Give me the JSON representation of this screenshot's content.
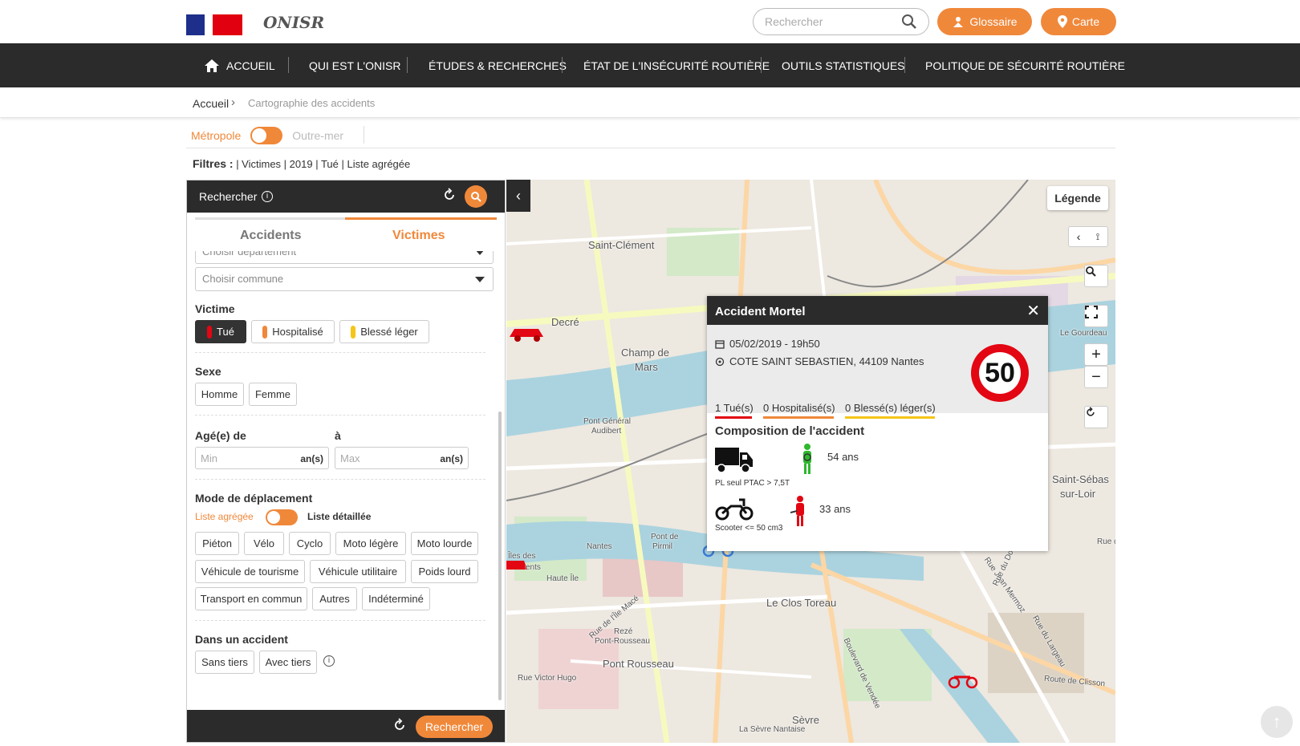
{
  "header": {
    "logo_text": "ONISR",
    "search_placeholder": "Rechercher",
    "glossaire_label": "Glossaire",
    "carte_label": "Carte"
  },
  "nav": {
    "items": [
      {
        "label": "ACCUEIL"
      },
      {
        "label": "QUI EST L'ONISR"
      },
      {
        "label": "ÉTUDES & RECHERCHES"
      },
      {
        "label": "ÉTAT DE L'INSÉCURITÉ ROUTIÈRE"
      },
      {
        "label": "OUTILS STATISTIQUES"
      },
      {
        "label": "POLITIQUE DE SÉCURITÉ ROUTIÈRE"
      }
    ]
  },
  "breadcrumb": {
    "home": "Accueil",
    "current": "Cartographie des accidents"
  },
  "region": {
    "metropole": "Métropole",
    "outremer": "Outre-mer"
  },
  "filters": {
    "label": "Filtres :",
    "value": " | Victimes | 2019 | Tué | Liste agrégée"
  },
  "panel": {
    "title": "Rechercher",
    "tabs": {
      "accidents": "Accidents",
      "victimes": "Victimes"
    },
    "departement_placeholder": "Choisir département",
    "commune_placeholder": "Choisir commune",
    "victime": {
      "label": "Victime",
      "options": [
        "Tué",
        "Hospitalisé",
        "Blessé léger"
      ]
    },
    "sexe": {
      "label": "Sexe",
      "options": [
        "Homme",
        "Femme"
      ]
    },
    "age": {
      "label_from": "Agé(e) de",
      "label_to": "à",
      "min_placeholder": "Min",
      "max_placeholder": "Max",
      "unit": "an(s)"
    },
    "mode": {
      "label": "Mode de déplacement",
      "toggle_left": "Liste agrégée",
      "toggle_right": "Liste détaillée",
      "options": [
        "Piéton",
        "Vélo",
        "Cyclo",
        "Moto légère",
        "Moto lourde",
        "Véhicule de tourisme",
        "Véhicule utilitaire",
        "Poids lourd",
        "Transport en commun",
        "Autres",
        "Indéterminé"
      ]
    },
    "accident": {
      "label": "Dans un accident",
      "options": [
        "Sans tiers",
        "Avec tiers"
      ]
    },
    "search_button": "Rechercher"
  },
  "map": {
    "legend_button": "Légende",
    "labels": [
      "Saint-Clément",
      "Decré",
      "Champ de",
      "Mars",
      "Pont Général",
      "Audibert",
      "Pont de",
      "Pirmil",
      "Haute Île",
      "Nantes",
      "Rezé",
      "Pont-Rousseau",
      "Pont Rousseau",
      "Le Clos Toreau",
      "Saint-Sébas",
      "sur-Loir",
      "Sèvre",
      "Le Gourdeau",
      "Rue de l'Île Macé",
      "Boulevard de Vendée",
      "Route de Clisson",
      "Rue Victor Hugo",
      "La Sèvre Nantaise",
      "Rue Jean Mermoz",
      "Rue du Doubet",
      "Rue du Largeau",
      "Rue du",
      "Îles des",
      "ents"
    ],
    "zoom_in": "+",
    "zoom_out": "−"
  },
  "popup": {
    "title": "Accident Mortel",
    "datetime": "05/02/2019 - 19h50",
    "address": "COTE SAINT SEBASTIEN, 44109 Nantes",
    "tues": "1 Tué(s)",
    "hospitalises": "0 Hospitalisé(s)",
    "blesses": "0 Blessé(s) léger(s)",
    "speed_limit": "50",
    "composition_title": "Composition de l'accident",
    "vehicles": [
      {
        "caption": "PL seul PTAC > 7,5T",
        "person_age": "54 ans",
        "icon": "truck-icon"
      },
      {
        "caption": "Scooter <= 50 cm3",
        "person_age": "33 ans",
        "icon": "scooter-icon"
      }
    ]
  },
  "colors": {
    "accent": "#f0883a",
    "dark": "#2b2b2b",
    "killed": "#e30613",
    "hospital": "#f0883a",
    "light": "#f5c518",
    "unharmed": "#2db82d"
  }
}
